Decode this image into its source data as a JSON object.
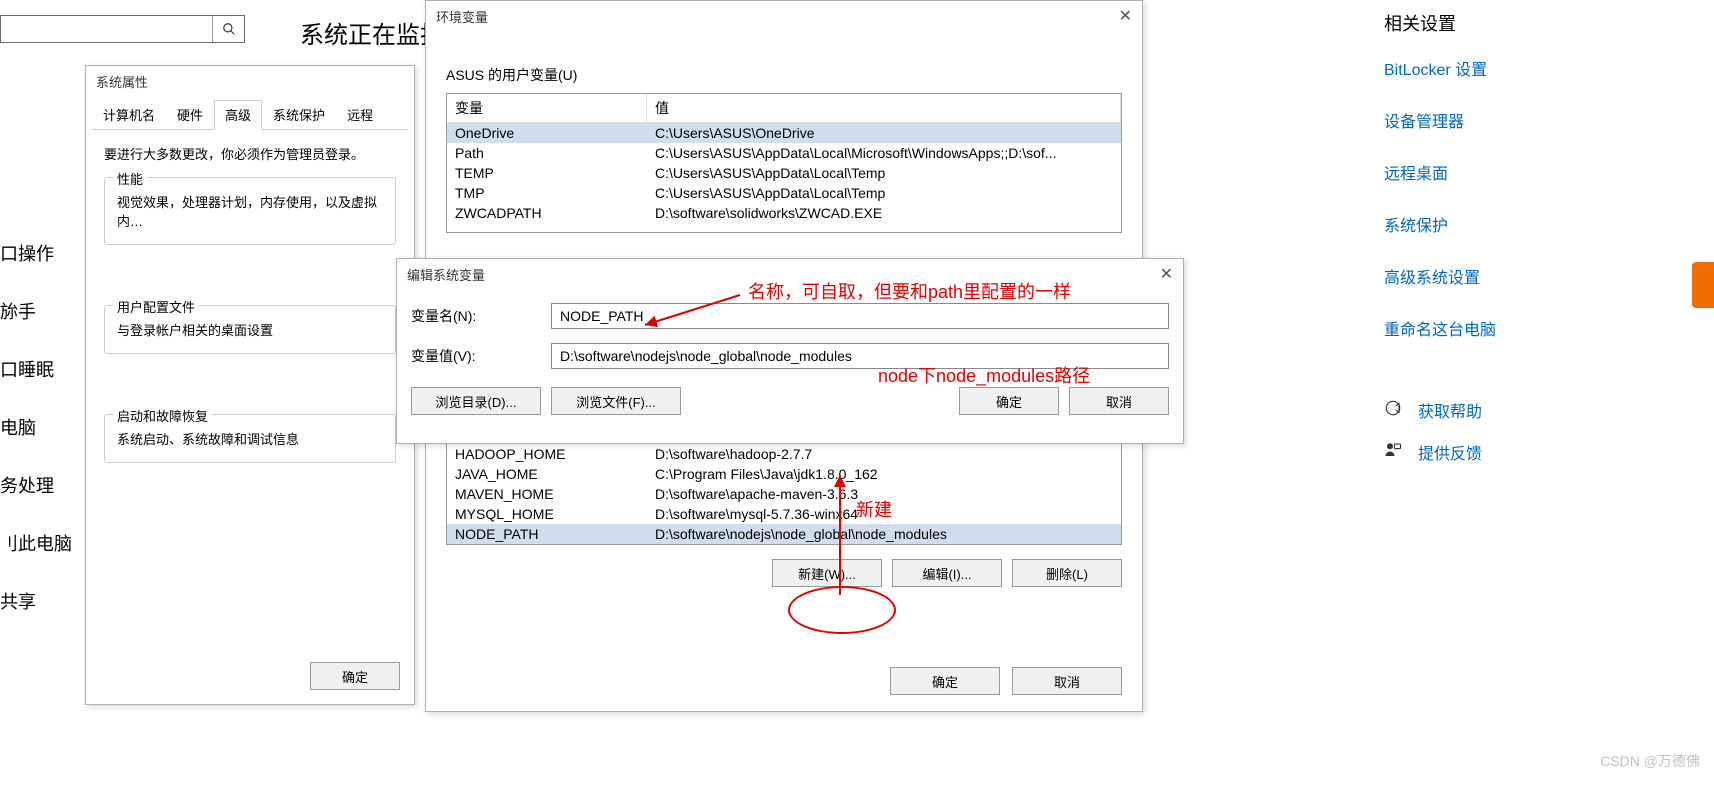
{
  "search": {
    "placeholder": ""
  },
  "bg_title": "系统正在监扛",
  "left_nav": [
    "口操作",
    "旀手",
    "口睡眠",
    "电脑",
    "务处理",
    "刂此电脑",
    "共享"
  ],
  "right": {
    "heading": "相关设置",
    "links": [
      "BitLocker 设置",
      "设备管理器",
      "远程桌面",
      "系统保护",
      "高级系统设置",
      "重命名这台电脑"
    ],
    "help": "获取帮助",
    "feedback": "提供反馈"
  },
  "sysprops": {
    "title": "系统属性",
    "tabs": [
      "计算机名",
      "硬件",
      "高级",
      "系统保护",
      "远程"
    ],
    "admin_note": "要进行大多数更改，你必须作为管理员登录。",
    "perf_legend": "性能",
    "perf_text": "视觉效果，处理器计划，内存使用，以及虚拟内…",
    "profile_legend": "用户配置文件",
    "profile_text": "与登录帐户相关的桌面设置",
    "startup_legend": "启动和故障恢复",
    "startup_text": "系统启动、系统故障和调试信息",
    "ok": "确定"
  },
  "envvars": {
    "title": "环境变量",
    "user_section": "ASUS 的用户变量(U)",
    "col_var": "变量",
    "col_val": "值",
    "user_rows": [
      {
        "k": "OneDrive",
        "v": "C:\\Users\\ASUS\\OneDrive"
      },
      {
        "k": "Path",
        "v": "C:\\Users\\ASUS\\AppData\\Local\\Microsoft\\WindowsApps;;D:\\sof..."
      },
      {
        "k": "TEMP",
        "v": "C:\\Users\\ASUS\\AppData\\Local\\Temp"
      },
      {
        "k": "TMP",
        "v": "C:\\Users\\ASUS\\AppData\\Local\\Temp"
      },
      {
        "k": "ZWCADPATH",
        "v": "D:\\software\\solidworks\\ZWCAD.EXE"
      }
    ],
    "sys_rows": [
      {
        "k": "HADOOP_HOME",
        "v": "D:\\software\\hadoop-2.7.7"
      },
      {
        "k": "JAVA_HOME",
        "v": "C:\\Program Files\\Java\\jdk1.8.0_162"
      },
      {
        "k": "MAVEN_HOME",
        "v": "D:\\software\\apache-maven-3.6.3"
      },
      {
        "k": "MYSQL_HOME",
        "v": "D:\\software\\mysql-5.7.36-winx64"
      },
      {
        "k": "NODE_PATH",
        "v": "D:\\software\\nodejs\\node_global\\node_modules"
      }
    ],
    "new": "新建(W)...",
    "edit": "编辑(I)...",
    "del": "删除(L)",
    "ok": "确定",
    "cancel": "取消"
  },
  "editdlg": {
    "title": "编辑系统变量",
    "name_label": "变量名(N):",
    "name_value": "NODE_PATH",
    "val_label": "变量值(V):",
    "val_value": "D:\\software\\nodejs\\node_global\\node_modules",
    "browse_dir": "浏览目录(D)...",
    "browse_file": "浏览文件(F)...",
    "ok": "确定",
    "cancel": "取消"
  },
  "annotations": {
    "name_note": "名称，可自取，但要和path里配置的一样",
    "val_note": "node下node_modules路径",
    "new_note": "新建"
  },
  "watermark": "CSDN @万德佛"
}
